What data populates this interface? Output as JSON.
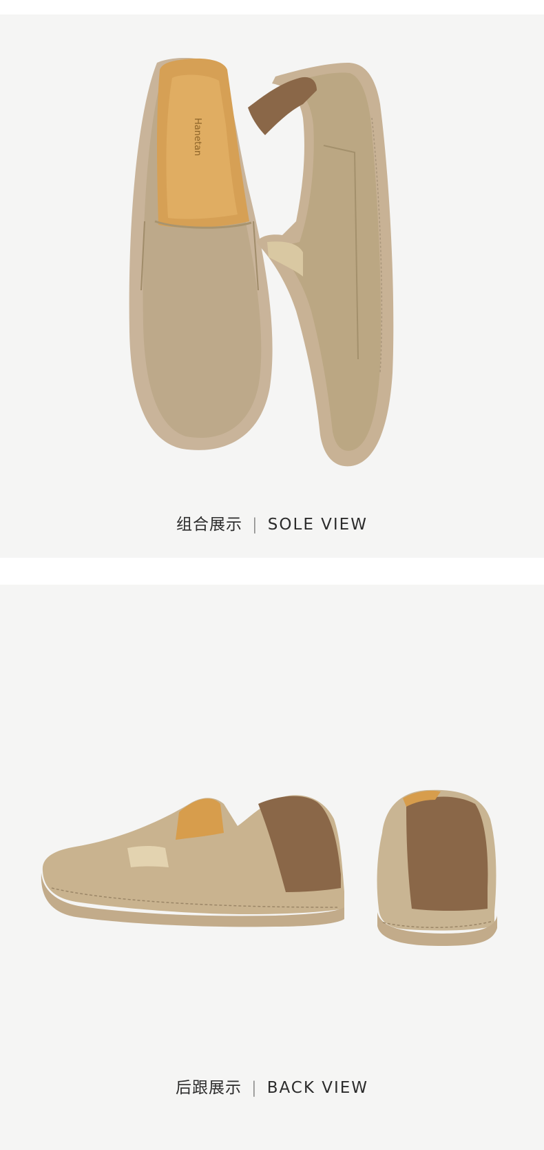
{
  "panels": [
    {
      "caption_cn": "组合展示",
      "separator": "|",
      "caption_en": "SOLE  VIEW"
    },
    {
      "caption_cn": "后跟展示",
      "separator": "|",
      "caption_en": "BACK  VIEW"
    }
  ],
  "insole_brand": "Hanetan",
  "colors": {
    "background": "#f5f5f4",
    "upper": "#bda98a",
    "sole": "#c8b295",
    "heel_leather": "#8a6748",
    "insole": "#d39a45"
  }
}
